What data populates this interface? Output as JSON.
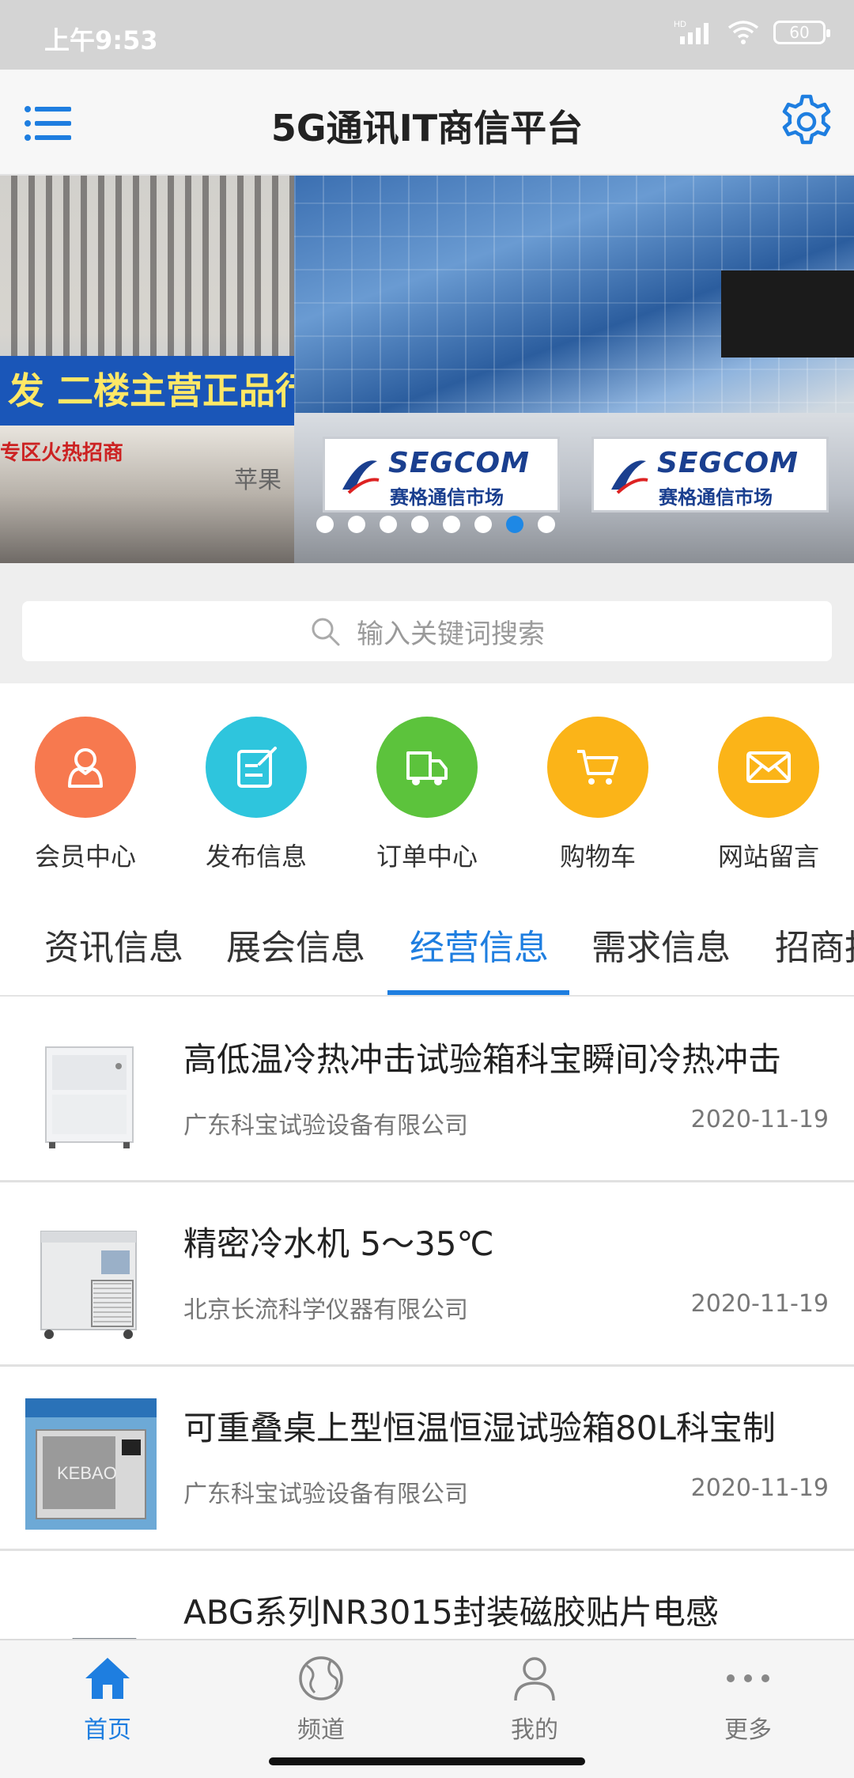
{
  "status_bar": {
    "time": "上午9:53",
    "battery": "60",
    "hd_label": "HD"
  },
  "header": {
    "title": "5G通讯IT商信平台"
  },
  "banner": {
    "left_sign_text": "发 二楼主营正品行",
    "left_shop_text": "专区火热招商",
    "left_apple_text": "苹果",
    "sign_name": "SEGCOM",
    "sign_sub": "赛格通信市场",
    "dots_count": 8,
    "active_dot": 6
  },
  "search": {
    "placeholder": "输入关键词搜索"
  },
  "quick_links": [
    {
      "label": "会员中心",
      "color": "#f7794f",
      "icon": "user-icon"
    },
    {
      "label": "发布信息",
      "color": "#2ec5dd",
      "icon": "edit-icon"
    },
    {
      "label": "订单中心",
      "color": "#5cc33c",
      "icon": "truck-icon"
    },
    {
      "label": "购物车",
      "color": "#fbb418",
      "icon": "cart-icon"
    },
    {
      "label": "网站留言",
      "color": "#fbb418",
      "icon": "mail-icon"
    }
  ],
  "tabs": [
    {
      "label": "资讯信息",
      "active": false
    },
    {
      "label": "展会信息",
      "active": false
    },
    {
      "label": "经营信息",
      "active": true
    },
    {
      "label": "需求信息",
      "active": false
    },
    {
      "label": "招商报",
      "active": false
    }
  ],
  "list": [
    {
      "title": "高低温冷热冲击试验箱科宝瞬间冷热冲击",
      "company": "广东科宝试验设备有限公司",
      "date": "2020-11-19"
    },
    {
      "title": "精密冷水机 5～35℃",
      "company": "北京长流科学仪器有限公司",
      "date": "2020-11-19"
    },
    {
      "title": "可重叠桌上型恒温恒湿试验箱80L科宝制",
      "company": "广东科宝试验设备有限公司",
      "date": "2020-11-19"
    },
    {
      "title": "ABG系列NR3015封装磁胶贴片电感",
      "company": "",
      "date": ""
    }
  ],
  "thumb3_text": "KEBAO",
  "bottom_nav": [
    {
      "label": "首页",
      "active": true,
      "icon": "home-icon"
    },
    {
      "label": "频道",
      "active": false,
      "icon": "globe-icon"
    },
    {
      "label": "我的",
      "active": false,
      "icon": "person-icon"
    },
    {
      "label": "更多",
      "active": false,
      "icon": "more-icon"
    }
  ],
  "colors": {
    "accent": "#1e7ee0"
  }
}
